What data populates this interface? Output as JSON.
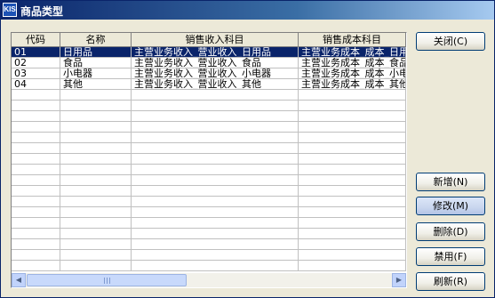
{
  "window": {
    "title": "商品类型",
    "app_icon_text": "KIS"
  },
  "grid": {
    "columns": [
      "代码",
      "名称",
      "销售收入科目",
      "销售成本科目"
    ],
    "rows": [
      [
        "01",
        "日用品",
        "主营业务收入_营业收入_日用品",
        "主营业务成本_成本_日用品"
      ],
      [
        "02",
        "食品",
        "主营业务收入_营业收入_食品",
        "主营业务成本_成本_食品"
      ],
      [
        "03",
        "小电器",
        "主营业务收入_营业收入_小电器",
        "主营业务成本_成本_小电器"
      ],
      [
        "04",
        "其他",
        "主营业务收入_营业收入_其他",
        "主营业务成本_成本_其他"
      ]
    ],
    "selected_row_index": 0,
    "scroll_left_glyph": "◀",
    "scroll_right_glyph": "▶"
  },
  "buttons": {
    "close": "关闭(C)",
    "new": "新增(N)",
    "edit": "修改(M)",
    "delete": "删除(D)",
    "disable": "禁用(F)",
    "refresh": "刷新(R)"
  },
  "colors": {
    "selection": "#0a246a",
    "title_bar": "#0a246a"
  }
}
